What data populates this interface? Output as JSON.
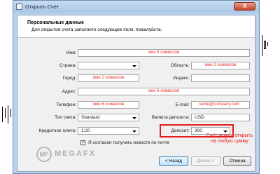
{
  "window": {
    "title": "Открыть Счет",
    "close_glyph": "X"
  },
  "header": {
    "title": "Персональные данные",
    "subtitle": "Для открытия счета заполните следующие поля, пожалуйста:"
  },
  "form": {
    "name": {
      "label": "Имя:",
      "hint": "мин 6 символов"
    },
    "country": {
      "label": "Страна:",
      "value": ""
    },
    "region": {
      "label": "Область:",
      "hint": "мин 2 символов"
    },
    "city": {
      "label": "Город:",
      "hint": "мин 2 символов"
    },
    "zip": {
      "label": "Индекс:",
      "value": ""
    },
    "address": {
      "label": "Адрес:",
      "hint": "мин 6 символов"
    },
    "phone": {
      "label": "Телефон:",
      "hint": "мин 6 символов"
    },
    "email": {
      "label": "E-mail:",
      "hint": "name@company.com"
    },
    "account_type": {
      "label": "Тип счета:",
      "value": "Standard"
    },
    "currency": {
      "label": "Валюта депозита:",
      "value": "USD"
    },
    "leverage": {
      "label": "Кредитное плечо:",
      "value": "1:20"
    },
    "deposit": {
      "label": "Депозит:",
      "value": "300"
    },
    "newsletter": {
      "label": "Я согласен получать новости по почте",
      "checked": true
    }
  },
  "annotation": {
    "line1": "Счёт можно открыть",
    "line2": "на любую сумму"
  },
  "buttons": {
    "back": "< Назад",
    "next": "Далее >",
    "cancel": "Отмена"
  },
  "logo": {
    "mark": "MF",
    "text": "MEGAFX"
  },
  "colors": {
    "hint_red": "#e8332a",
    "highlight_red": "#e21d1d",
    "window_frame": "#b9d1ea"
  }
}
